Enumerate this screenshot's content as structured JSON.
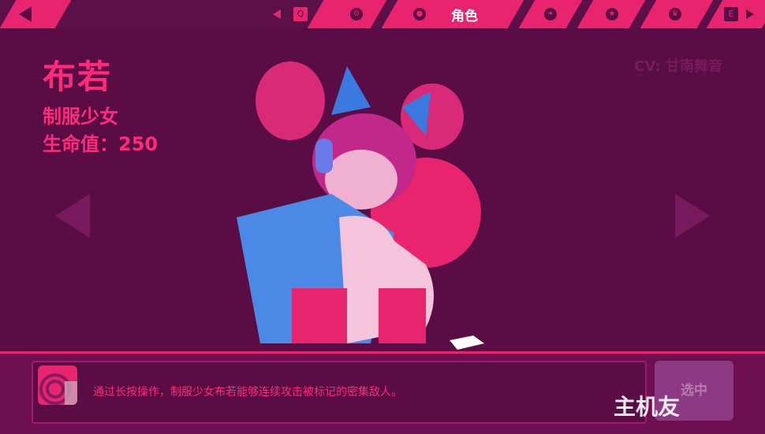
{
  "topbar": {
    "active_tab_label": "角色",
    "tabs": [
      {
        "icon": "gear-icon"
      },
      {
        "icon": "person-icon",
        "label": "角色"
      },
      {
        "icon": "leaf-icon"
      },
      {
        "icon": "star-icon"
      },
      {
        "icon": "trophy-icon"
      }
    ],
    "left_key": "Q",
    "right_key": "E"
  },
  "character": {
    "name": "布若",
    "title": "制服少女",
    "hp": "生命值：250",
    "cv": "CV: 甘南舞音"
  },
  "description": {
    "text": "通过长按操作，制服少女布若能够连续攻击被标记的密集敌人。"
  },
  "select_button": {
    "label": "选中"
  },
  "watermark": {
    "text": "主机友"
  },
  "colors": {
    "accent": "#e8246e",
    "bg": "#5a0c44",
    "text": "#ff2a79"
  }
}
